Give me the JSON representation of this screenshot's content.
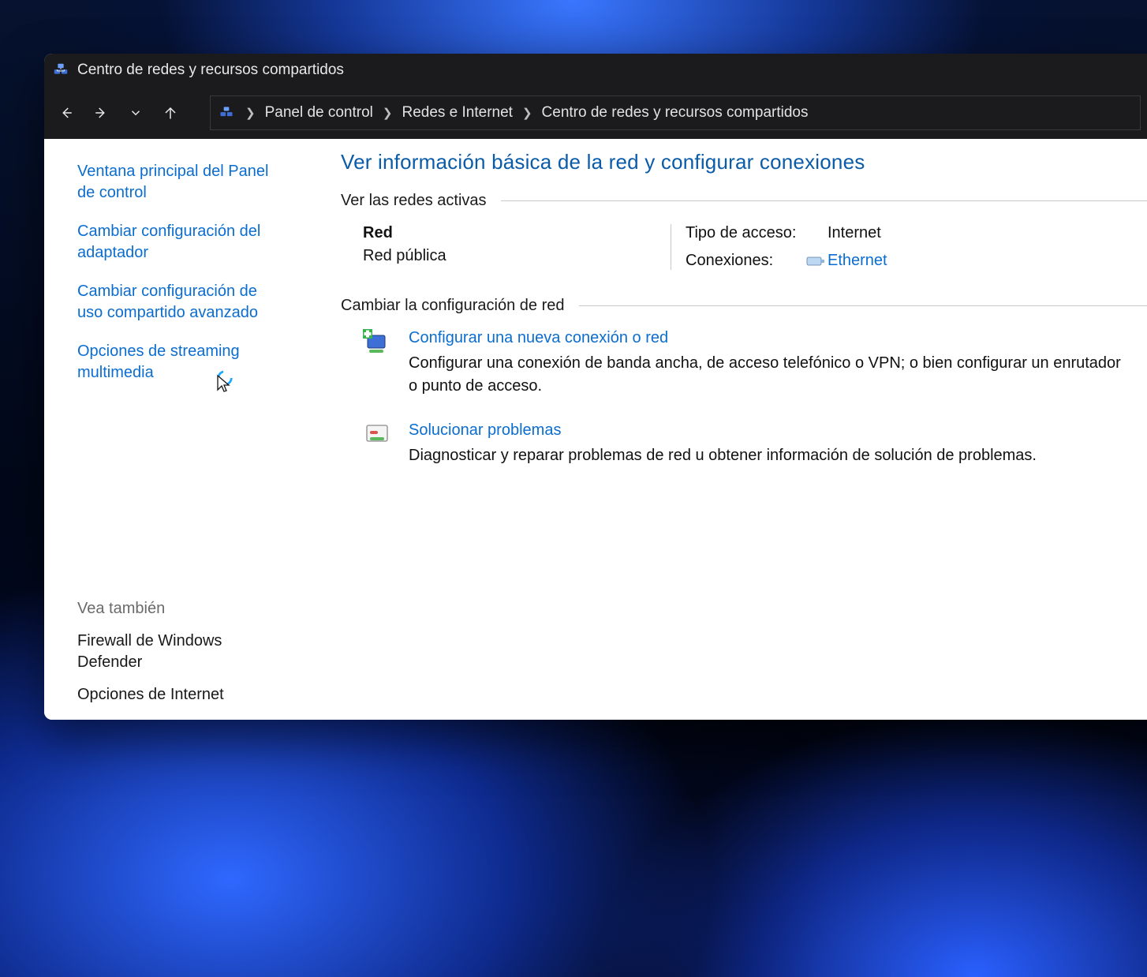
{
  "window": {
    "title": "Centro de redes y recursos compartidos"
  },
  "breadcrumb": {
    "items": [
      "Panel de control",
      "Redes e Internet",
      "Centro de redes y recursos compartidos"
    ]
  },
  "sidebar": {
    "links": [
      "Ventana principal del Panel de control",
      "Cambiar configuración del adaptador",
      "Cambiar configuración de uso compartido avanzado",
      "Opciones de streaming multimedia"
    ],
    "see_also_heading": "Vea también",
    "see_also": [
      "Firewall de Windows Defender",
      "Opciones de Internet"
    ]
  },
  "content": {
    "title": "Ver información básica de la red y configurar conexiones",
    "active_nets_heading": "Ver las redes activas",
    "network": {
      "name": "Red",
      "kind": "Red pública",
      "access_label": "Tipo de acceso:",
      "access_value": "Internet",
      "conn_label": "Conexiones:",
      "conn_link": "Ethernet"
    },
    "change_heading": "Cambiar la configuración de red",
    "tasks": [
      {
        "title": "Configurar una nueva conexión o red",
        "desc": "Configurar una conexión de banda ancha, de acceso telefónico o VPN; o bien configurar un enrutador o punto de acceso."
      },
      {
        "title": "Solucionar problemas",
        "desc": "Diagnosticar y reparar problemas de red u obtener información de solución de problemas."
      }
    ]
  }
}
